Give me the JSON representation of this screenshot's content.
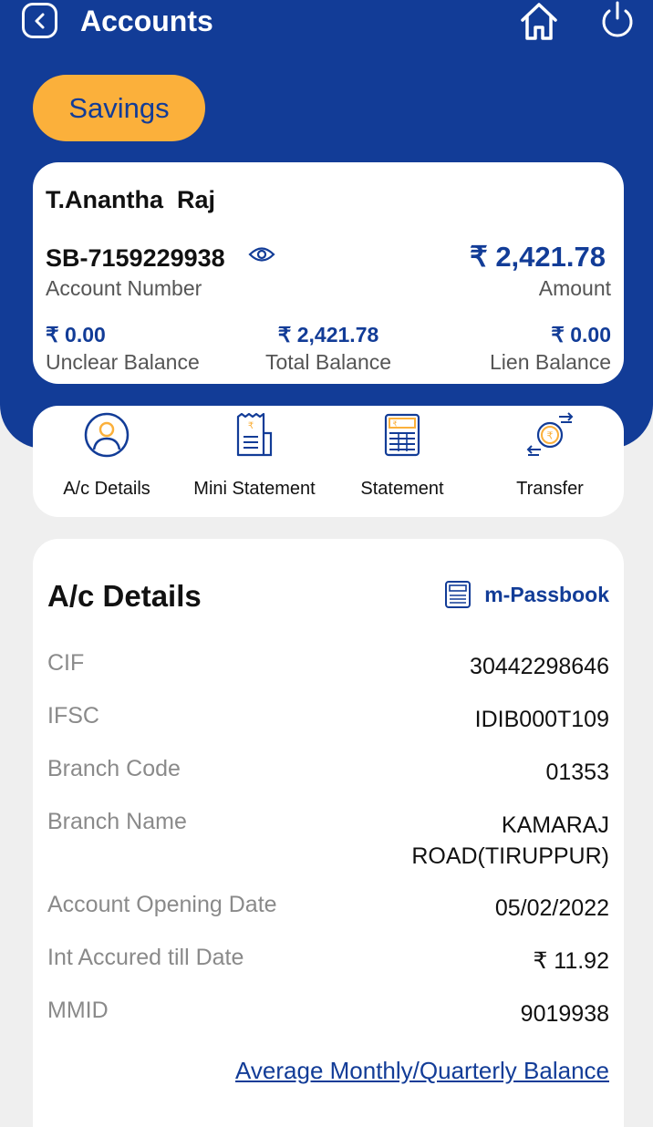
{
  "header": {
    "title": "Accounts"
  },
  "tab": {
    "label": "Savings"
  },
  "account": {
    "holder_name": "T.Anantha  Raj",
    "number": "SB-7159229938",
    "number_label": "Account Number",
    "amount": "₹ 2,421.78",
    "amount_label": "Amount",
    "unclear_value": "₹ 0.00",
    "unclear_label": "Unclear Balance",
    "total_value": "₹ 2,421.78",
    "total_label": "Total Balance",
    "lien_value": "₹ 0.00",
    "lien_label": "Lien Balance"
  },
  "actions": [
    {
      "label": "A/c Details",
      "icon": "user-circle-icon"
    },
    {
      "label": "Mini Statement",
      "icon": "receipt-icon"
    },
    {
      "label": "Statement",
      "icon": "statement-icon"
    },
    {
      "label": "Transfer",
      "icon": "transfer-icon"
    }
  ],
  "details": {
    "title": "A/c Details",
    "passbook_label": "m-Passbook",
    "rows": [
      {
        "label": "CIF",
        "value": "30442298646"
      },
      {
        "label": "IFSC",
        "value": "IDIB000T109"
      },
      {
        "label": "Branch Code",
        "value": "01353"
      },
      {
        "label": "Branch Name",
        "value_line1": "KAMARAJ",
        "value_line2": "ROAD(TIRUPPUR)"
      },
      {
        "label": "Account Opening Date",
        "value": "05/02/2022"
      },
      {
        "label": "Int Accured till Date",
        "value": "₹ 11.92"
      },
      {
        "label": "MMID",
        "value": "9019938"
      }
    ],
    "link": "Average Monthly/Quarterly Balance"
  },
  "colors": {
    "primary": "#123c97",
    "accent": "#fbb03b",
    "background": "#efefef"
  }
}
